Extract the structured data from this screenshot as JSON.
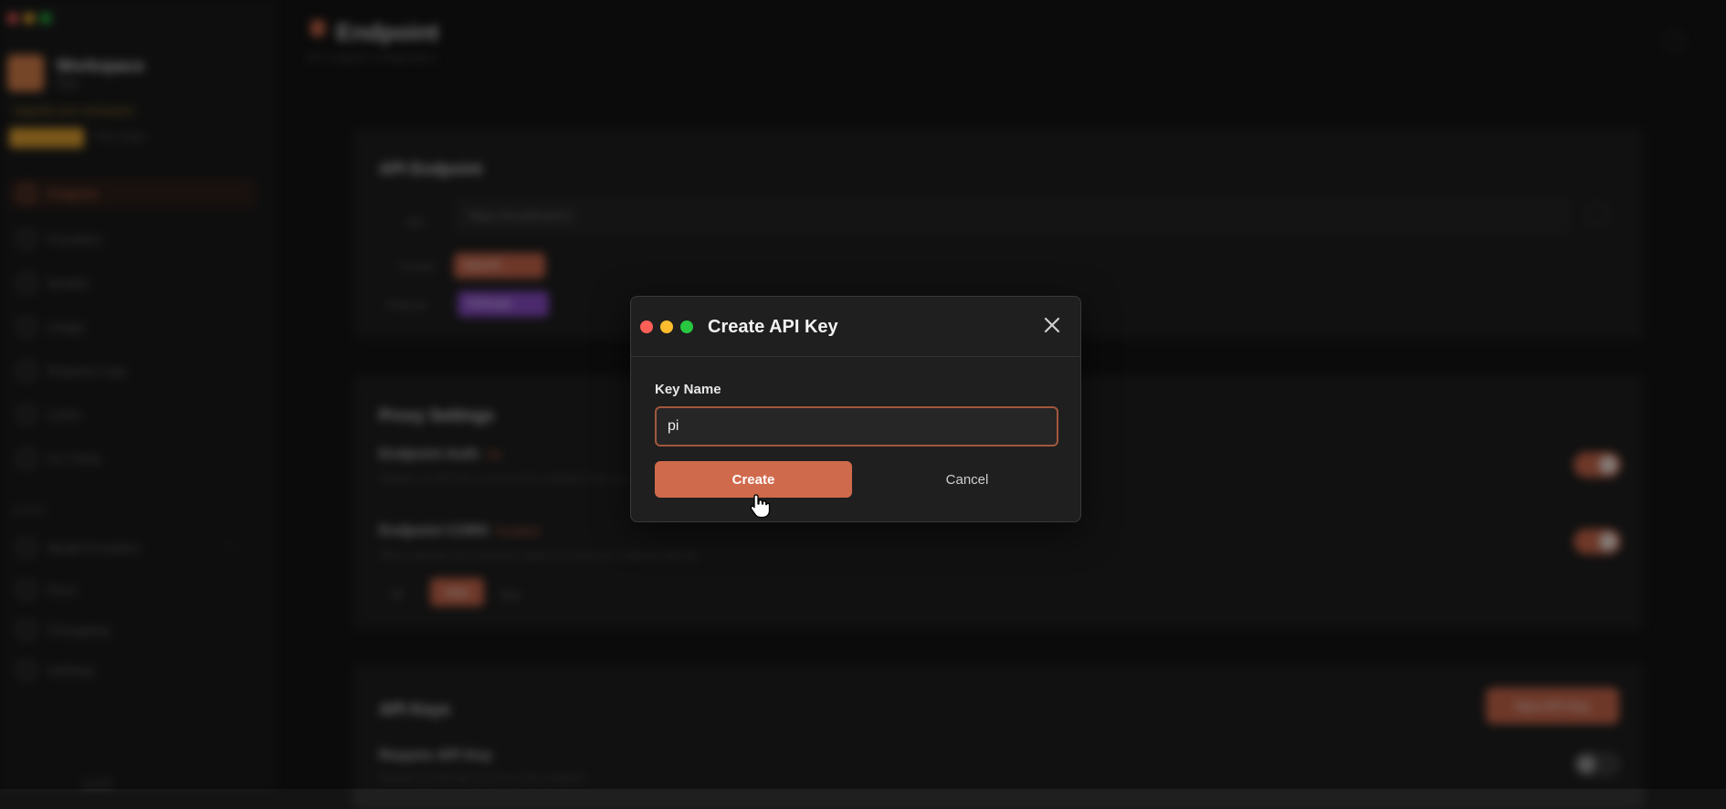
{
  "background": {
    "sidebar": {
      "brand_name": "Workspace",
      "brand_sub": "Free",
      "plan_line": "Upgrade your workspace",
      "plan_extra": "Plan usage",
      "items": [
        {
          "label": "Endpoint",
          "active": true
        },
        {
          "label": "Providers"
        },
        {
          "label": "Models"
        },
        {
          "label": "Usage"
        },
        {
          "label": "Request Logs"
        },
        {
          "label": "Limits"
        },
        {
          "label": "CLI Tools"
        }
      ],
      "section_label": "MORE",
      "more_items": [
        {
          "label": "Model Providers",
          "badge": "+"
        },
        {
          "label": "Docs"
        },
        {
          "label": "Changelog"
        },
        {
          "label": "Settings"
        }
      ],
      "footer": "v1.0.0"
    },
    "page": {
      "title": "Endpoint",
      "subtitle": "API endpoint configuration"
    },
    "api_endpoint": {
      "title": "API Endpoint",
      "url_label": "URL",
      "url": "https://localhost/v1",
      "format_label": "Format",
      "format_chip": "OpenAI",
      "protocol_label": "Protocol",
      "protocol_chip": "Anthropic"
    },
    "proxy_options": {
      "title": "Proxy Settings",
      "opt1_title": "Endpoint Auth",
      "opt1_tag": "On",
      "opt1_desc": "Require an API key to access the endpoint from any client application.",
      "opt2_title": "Endpoint CORS",
      "opt2_tag": "Enabled",
      "opt2_desc": "Allow requests from browser origins to reach this endpoint directly.",
      "segments": [
        "All",
        "Web",
        "App"
      ]
    },
    "api_keys": {
      "title": "API Keys",
      "new_button": "New API Key",
      "require_title": "Require API Key",
      "require_desc": "Require an API key to access the endpoint"
    }
  },
  "modal": {
    "title": "Create API Key",
    "field_label": "Key Name",
    "input_value": "pi",
    "input_placeholder": "",
    "create_label": "Create",
    "cancel_label": "Cancel"
  },
  "colors": {
    "accent": "#d06a4c",
    "dot_red": "#ff5f57",
    "dot_yellow": "#febc2e",
    "dot_green": "#28c840"
  }
}
